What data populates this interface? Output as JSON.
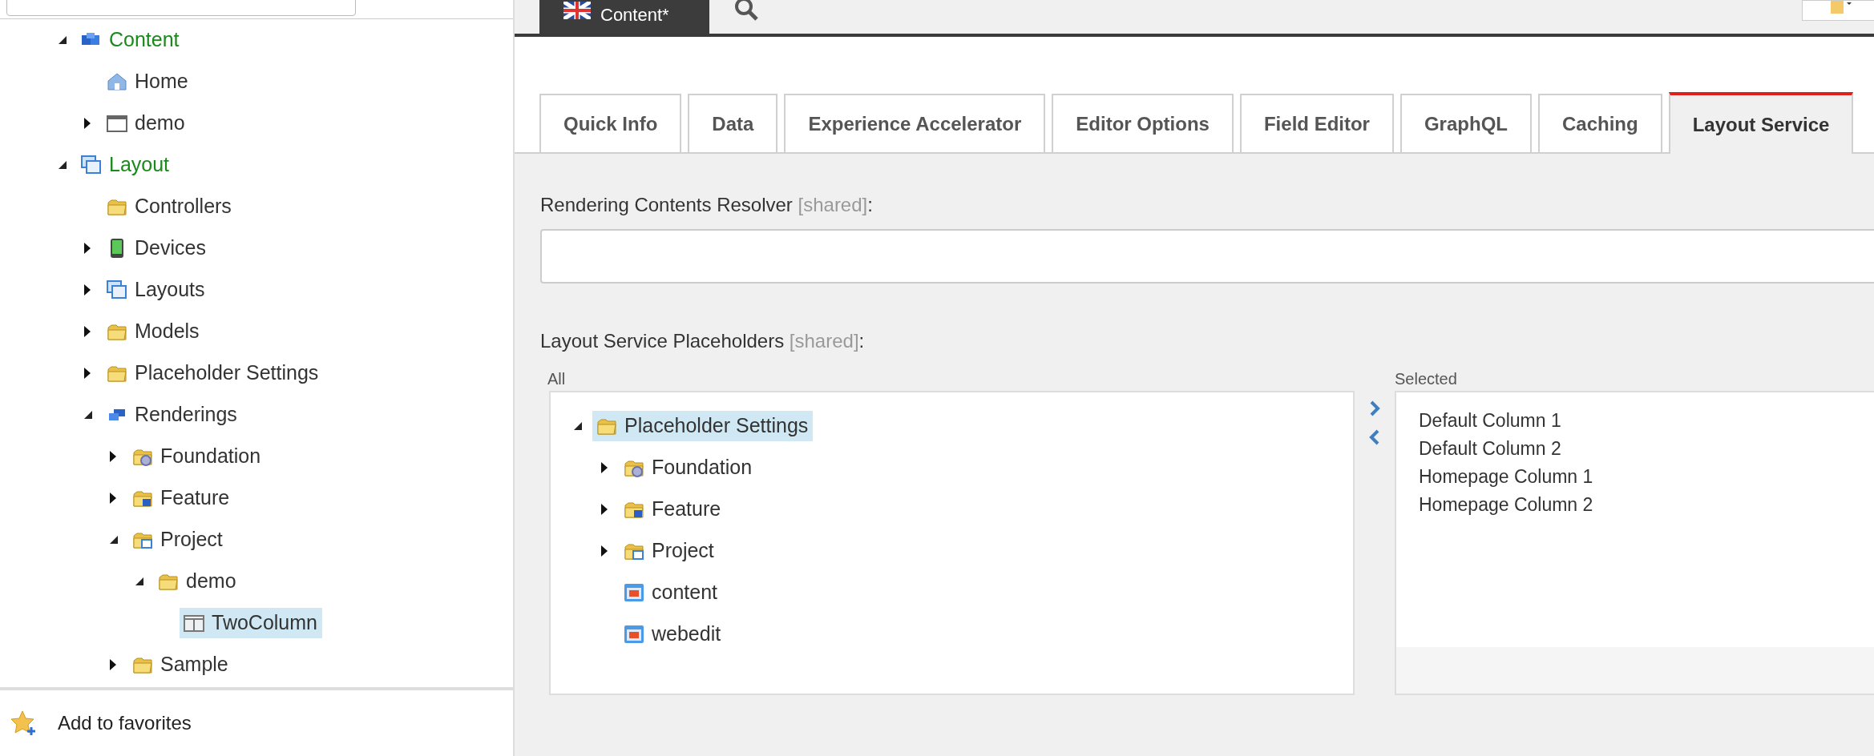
{
  "sidebar": {
    "tree": [
      {
        "label": "Content",
        "kind": "cubes",
        "expandable": true,
        "expanded": true,
        "emphasized": true,
        "selected": false,
        "children": [
          {
            "label": "Home",
            "kind": "home",
            "expandable": false,
            "emphasized": false,
            "selected": false
          },
          {
            "label": "demo",
            "kind": "page",
            "expandable": true,
            "expanded": false,
            "emphasized": false,
            "selected": false
          }
        ]
      },
      {
        "label": "Layout",
        "kind": "windows",
        "expandable": true,
        "expanded": true,
        "emphasized": true,
        "selected": false,
        "children": [
          {
            "label": "Controllers",
            "kind": "folder",
            "expandable": false,
            "emphasized": false,
            "selected": false
          },
          {
            "label": "Devices",
            "kind": "device",
            "expandable": true,
            "expanded": false,
            "emphasized": false,
            "selected": false
          },
          {
            "label": "Layouts",
            "kind": "windows",
            "expandable": true,
            "expanded": false,
            "emphasized": false,
            "selected": false
          },
          {
            "label": "Models",
            "kind": "folder",
            "expandable": true,
            "expanded": false,
            "emphasized": false,
            "selected": false
          },
          {
            "label": "Placeholder Settings",
            "kind": "folder",
            "expandable": true,
            "expanded": false,
            "emphasized": false,
            "selected": false
          },
          {
            "label": "Renderings",
            "kind": "renderings",
            "expandable": true,
            "expanded": true,
            "emphasized": false,
            "selected": false,
            "children": [
              {
                "label": "Foundation",
                "kind": "gearfolder",
                "expandable": true,
                "expanded": false,
                "emphasized": false,
                "selected": false
              },
              {
                "label": "Feature",
                "kind": "featurefolder",
                "expandable": true,
                "expanded": false,
                "emphasized": false,
                "selected": false
              },
              {
                "label": "Project",
                "kind": "projectfolder",
                "expandable": true,
                "expanded": true,
                "emphasized": false,
                "selected": false,
                "children": [
                  {
                    "label": "demo",
                    "kind": "folder",
                    "expandable": true,
                    "expanded": true,
                    "emphasized": false,
                    "selected": false,
                    "children": [
                      {
                        "label": "TwoColumn",
                        "kind": "twocolumn",
                        "expandable": false,
                        "emphasized": false,
                        "selected": true
                      }
                    ]
                  }
                ]
              },
              {
                "label": "Sample",
                "kind": "folder",
                "expandable": true,
                "expanded": false,
                "emphasized": false,
                "selected": false
              }
            ]
          }
        ]
      }
    ],
    "favorites": "Add to favorites"
  },
  "editor_tab": {
    "label": "Content*"
  },
  "tabs": [
    {
      "label": "Quick Info",
      "selected": false
    },
    {
      "label": "Data",
      "selected": false
    },
    {
      "label": "Experience Accelerator",
      "selected": false
    },
    {
      "label": "Editor Options",
      "selected": false
    },
    {
      "label": "Field Editor",
      "selected": false
    },
    {
      "label": "GraphQL",
      "selected": false
    },
    {
      "label": "Caching",
      "selected": false
    },
    {
      "label": "Layout Service",
      "selected": true
    }
  ],
  "resolver_field": {
    "label": "Rendering Contents Resolver",
    "note": "[shared]",
    "suffix": ":"
  },
  "placeholders_field": {
    "label": "Layout Service Placeholders",
    "note": "[shared]",
    "suffix": ":",
    "all_label": "All",
    "all_tree": [
      {
        "label": "Placeholder Settings",
        "kind": "folder",
        "expandable": true,
        "expanded": true,
        "emphasized": false,
        "selected": true,
        "children": [
          {
            "label": "Foundation",
            "kind": "gearfolder",
            "expandable": true,
            "expanded": false,
            "emphasized": false,
            "selected": false
          },
          {
            "label": "Feature",
            "kind": "featurefolder",
            "expandable": true,
            "expanded": false,
            "emphasized": false,
            "selected": false
          },
          {
            "label": "Project",
            "kind": "projectfolder",
            "expandable": true,
            "expanded": false,
            "emphasized": false,
            "selected": false
          },
          {
            "label": "content",
            "kind": "placeholder",
            "expandable": false,
            "emphasized": false,
            "selected": false
          },
          {
            "label": "webedit",
            "kind": "placeholder",
            "expandable": false,
            "emphasized": false,
            "selected": false
          }
        ]
      }
    ],
    "selected_label": "Selected",
    "selected_items": [
      "Default Column 1",
      "Default Column 2",
      "Homepage Column 1",
      "Homepage Column 2"
    ]
  }
}
